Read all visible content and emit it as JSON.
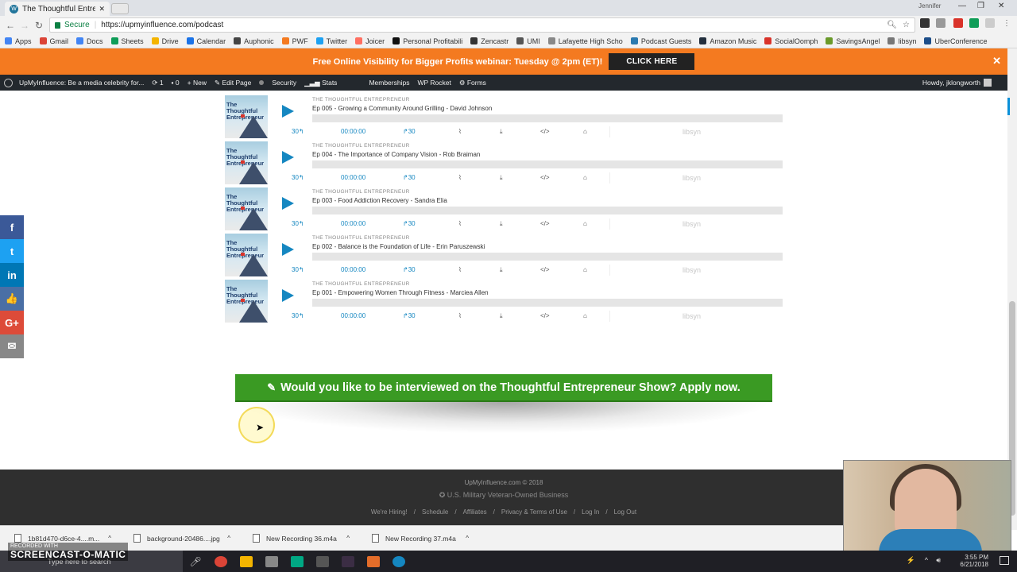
{
  "browser": {
    "tab_title": "The Thoughtful Entrepre",
    "user_label": "Jennifer",
    "secure_label": "Secure",
    "url": "https://upmyinfluence.com/podcast",
    "bookmarks": [
      {
        "label": "Apps",
        "color": "#4285f4"
      },
      {
        "label": "Gmail",
        "color": "#db4437"
      },
      {
        "label": "Docs",
        "color": "#4285f4"
      },
      {
        "label": "Sheets",
        "color": "#0f9d58"
      },
      {
        "label": "Drive",
        "color": "#f4b400"
      },
      {
        "label": "Calendar",
        "color": "#1a73e8"
      },
      {
        "label": "Auphonic",
        "color": "#444444"
      },
      {
        "label": "PWF",
        "color": "#f47a20"
      },
      {
        "label": "Twitter",
        "color": "#1da1f2"
      },
      {
        "label": "Joicer",
        "color": "#ff6f61"
      },
      {
        "label": "Personal Profitabili",
        "color": "#111111"
      },
      {
        "label": "Zencastr",
        "color": "#333333"
      },
      {
        "label": "UMI",
        "color": "#555555"
      },
      {
        "label": "Lafayette High Scho",
        "color": "#888888"
      },
      {
        "label": "Podcast Guests",
        "color": "#2a7ab0"
      },
      {
        "label": "Amazon Music",
        "color": "#232f3e"
      },
      {
        "label": "SocialOomph",
        "color": "#d9332a"
      },
      {
        "label": "SavingsAngel",
        "color": "#6a9a2a"
      },
      {
        "label": "libsyn",
        "color": "#777777"
      },
      {
        "label": "UberConference",
        "color": "#1d4e89"
      }
    ]
  },
  "banner": {
    "text": "Free Online Visibility for Bigger Profits webinar: Tuesday @ 2pm (ET)!",
    "cta": "CLICK HERE",
    "close": "✕"
  },
  "adminbar": {
    "site": "UpMyInfluence: Be a media celebrity for...",
    "updates": "1",
    "comments": "0",
    "new": "New",
    "edit": "Edit Page",
    "security": "Security",
    "stats": "Stats",
    "memberships": "Memberships",
    "wprocket": "WP Rocket",
    "forms": "Forms",
    "howdy": "Howdy, jklongworth"
  },
  "player": {
    "show_name": "THE THOUGHTFUL ENTREPRENEUR",
    "art_title": "The Thoughtful Entrepreneur",
    "back": "30↰",
    "time": "00:00:00",
    "fwd": "↱30",
    "libsyn": "libsyn",
    "episodes": [
      {
        "title": "Ep 005 - Growing a Community Around Grilling - David Johnson"
      },
      {
        "title": "Ep 004 - The Importance of Company Vision - Rob Braiman"
      },
      {
        "title": "Ep 003 - Food Addiction Recovery - Sandra Elia"
      },
      {
        "title": "Ep 002 - Balance is the Foundation of Life - Erin Paruszewski"
      },
      {
        "title": "Ep 001 - Empowering Women Through Fitness - Marciea Allen"
      }
    ]
  },
  "apply": {
    "text": "Would you like to be interviewed on the Thoughtful Entrepreneur Show? Apply now."
  },
  "social": [
    {
      "name": "facebook",
      "glyph": "f",
      "color": "#3b5998"
    },
    {
      "name": "twitter",
      "glyph": "t",
      "color": "#1da1f2"
    },
    {
      "name": "linkedin",
      "glyph": "in",
      "color": "#0077b5"
    },
    {
      "name": "like",
      "glyph": "👍",
      "color": "#4a6fa5"
    },
    {
      "name": "googleplus",
      "glyph": "G+",
      "color": "#dd4b39"
    },
    {
      "name": "email",
      "glyph": "✉",
      "color": "#888888"
    }
  ],
  "footer": {
    "copyright": "UpMyInfluence.com © 2018",
    "vet": "U.S. Military Veteran-Owned Business",
    "links": [
      "We're Hiring!",
      "Schedule",
      "Affiliates",
      "Privacy & Terms of Use",
      "Log In",
      "Log Out"
    ]
  },
  "downloads": [
    {
      "name": "1b81d470-d6ce-4....m..."
    },
    {
      "name": "background-20486....jpg"
    },
    {
      "name": "New Recording 36.m4a"
    },
    {
      "name": "New Recording 37.m4a"
    }
  ],
  "taskbar": {
    "search": "Type here to search",
    "time": "3:55 PM",
    "date": "6/21/2018"
  },
  "watermark": {
    "recorded": "RECORDED WITH",
    "brand": "SCREENCAST-O-MATIC"
  }
}
